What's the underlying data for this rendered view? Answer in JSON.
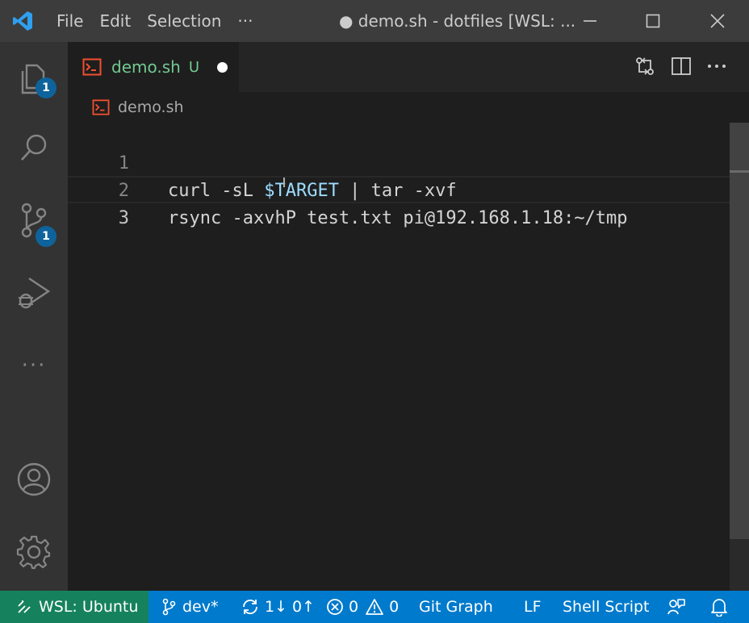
{
  "titlebar": {
    "menu": [
      "File",
      "Edit",
      "Selection",
      "···"
    ],
    "title": "● demo.sh - dotfiles [WSL: ..."
  },
  "activity": {
    "explorer_badge": "1",
    "scm_badge": "1",
    "more": "···"
  },
  "tab": {
    "label": "demo.sh",
    "status": "U",
    "label_color": "#73c991"
  },
  "breadcrumb": {
    "file": "demo.sh"
  },
  "editor": {
    "lines": [
      {
        "number": "1",
        "pre": "curl -sL ",
        "var": "$TARGET",
        "post": " | tar -xvf"
      },
      {
        "number": "2",
        "text": "rsync -axvhP test.txt pi@192.168.1.18:~/tmp"
      },
      {
        "number": "3",
        "text": ""
      }
    ],
    "variable_color": "#9cdcfe"
  },
  "statusbar": {
    "remote": "WSL: Ubuntu",
    "branch": "dev*",
    "sync": "1↓ 0↑",
    "errors": "0",
    "warnings": "0",
    "git_graph": "Git Graph",
    "eol": "LF",
    "language": "Shell Script",
    "remote_color": "#16825d",
    "bar_color": "#007acc"
  }
}
